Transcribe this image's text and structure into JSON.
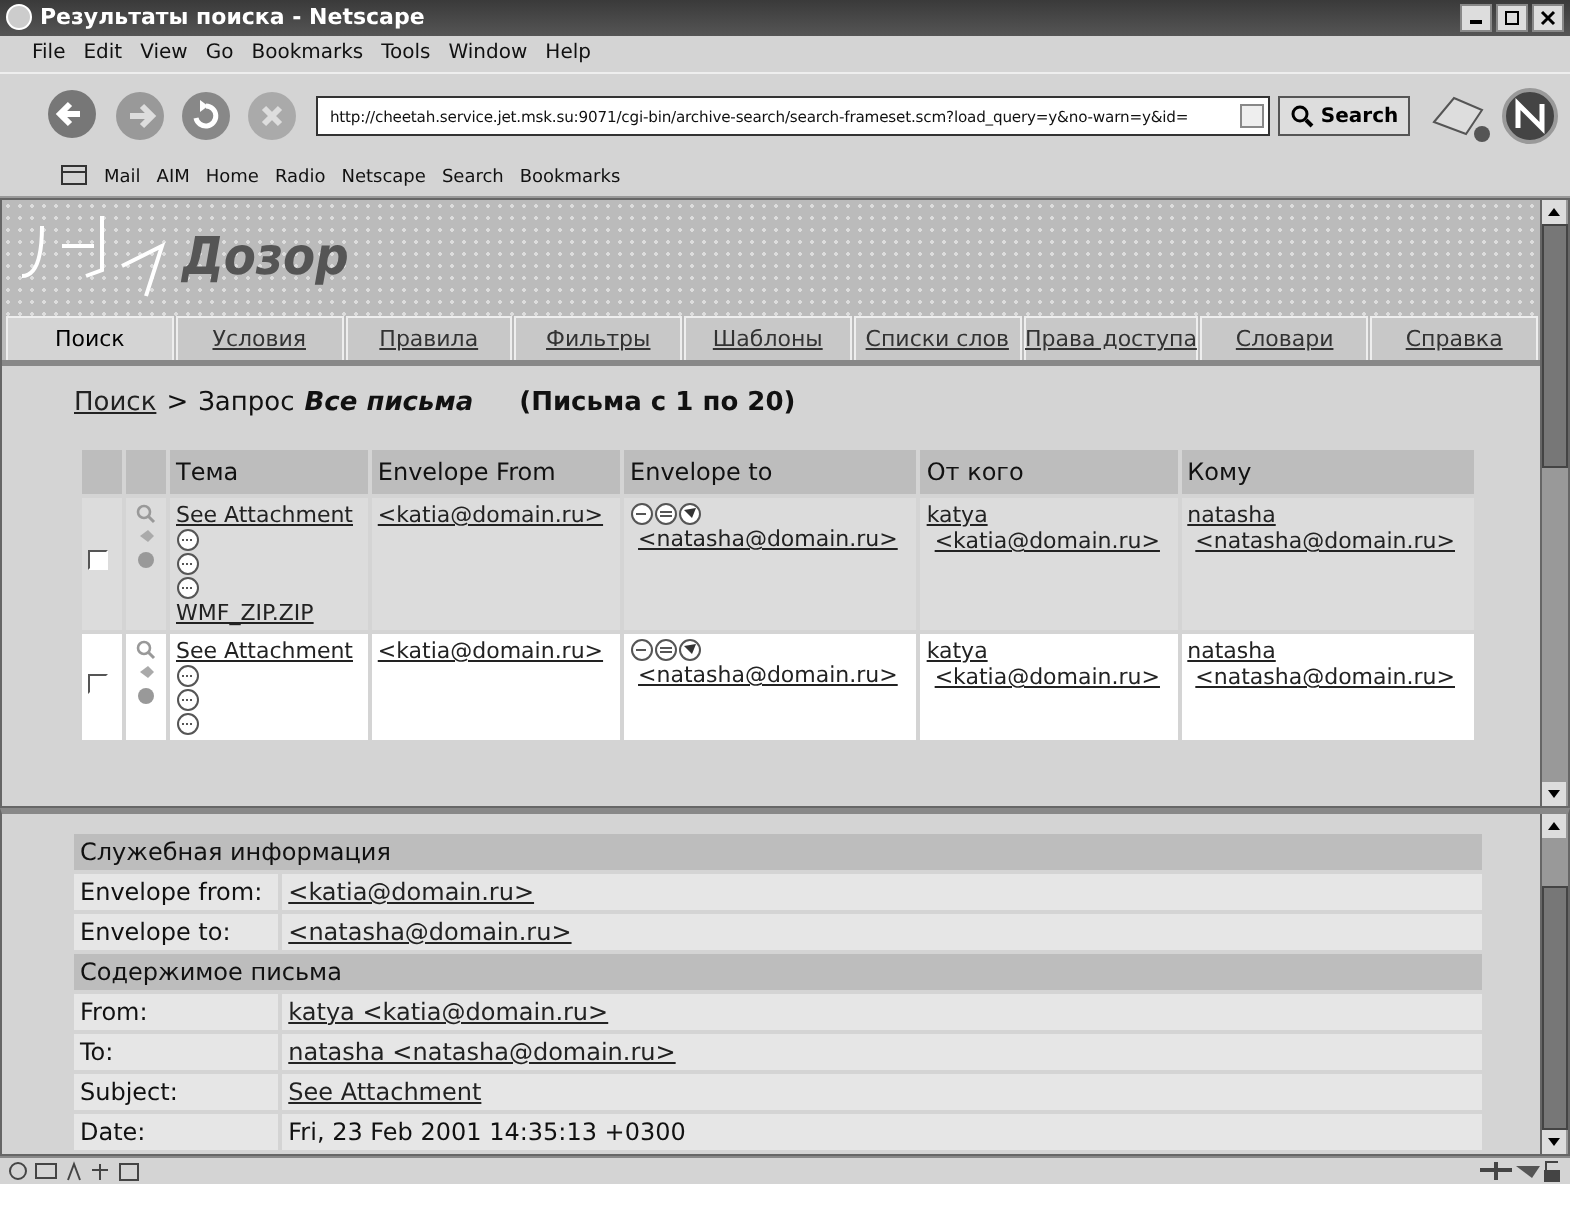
{
  "window": {
    "title": "Результаты поиска - Netscape"
  },
  "menu": [
    "File",
    "Edit",
    "View",
    "Go",
    "Bookmarks",
    "Tools",
    "Window",
    "Help"
  ],
  "address": {
    "value": "http://cheetah.service.jet.msk.su:9071/cgi-bin/archive-search/search-frameset.scm?load_query=y&no-warn=y&id="
  },
  "search_button": "Search",
  "personal_toolbar": [
    "Mail",
    "AIM",
    "Home",
    "Radio",
    "Netscape",
    "Search",
    "Bookmarks"
  ],
  "logo": {
    "text": "Дозор"
  },
  "tabs": [
    {
      "label": "Поиск",
      "selected": true
    },
    {
      "label": "Условия",
      "selected": false
    },
    {
      "label": "Правила",
      "selected": false
    },
    {
      "label": "Фильтры",
      "selected": false
    },
    {
      "label": "Шаблоны",
      "selected": false
    },
    {
      "label": "Списки слов",
      "selected": false
    },
    {
      "label": "Права доступа",
      "selected": false
    },
    {
      "label": "Словари",
      "selected": false
    },
    {
      "label": "Справка",
      "selected": false
    }
  ],
  "breadcrumb": {
    "link": "Поиск",
    "separator": ">",
    "label": "Запрос",
    "query": "Все письма",
    "range": "(Письма с 1 по 20)"
  },
  "table": {
    "columns": [
      "Тема",
      "Envelope From",
      "Envelope to",
      "От кого",
      "Кому"
    ],
    "rows": [
      {
        "selected": true,
        "checked": false,
        "subject": "See Attachment",
        "file": "WMF_ZIP.ZIP",
        "envelope_from": "<katia@domain.ru>",
        "envelope_to": "<natasha@domain.ru>",
        "from_name": "katya",
        "from_addr": "<katia@domain.ru>",
        "to_name": "natasha",
        "to_addr": "<natasha@domain.ru>"
      },
      {
        "selected": false,
        "checked": false,
        "subject": "See Attachment",
        "envelope_from": "<katia@domain.ru>",
        "envelope_to": "<natasha@domain.ru>",
        "from_name": "katya",
        "from_addr": "<katia@domain.ru>",
        "to_name": "natasha",
        "to_addr": "<natasha@domain.ru>"
      }
    ]
  },
  "details": [
    {
      "title": "Служебная информация",
      "fields": [
        {
          "label": "Envelope from:",
          "value": "<katia@domain.ru>",
          "kind": "link"
        },
        {
          "label": "Envelope to:",
          "value": "<natasha@domain.ru>",
          "kind": "link"
        }
      ]
    },
    {
      "title": "Содержимое письма",
      "fields": [
        {
          "label": "From:",
          "value": "katya <katia@domain.ru>",
          "kind": "link"
        },
        {
          "label": "To:",
          "value": "natasha <natasha@domain.ru>",
          "kind": "link"
        },
        {
          "label": "Subject:",
          "value": "See Attachment",
          "kind": "link"
        },
        {
          "label": "Date:",
          "value": "Fri, 23 Feb 2001 14:35:13 +0300",
          "kind": "text"
        }
      ]
    }
  ]
}
